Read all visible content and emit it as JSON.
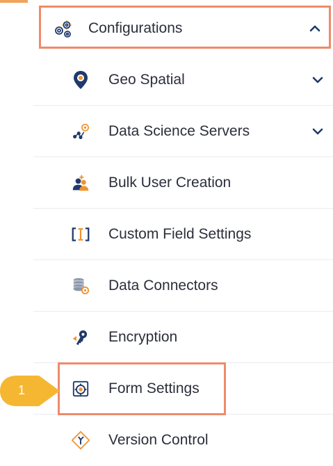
{
  "menu": {
    "header": {
      "label": "Configurations",
      "icon": "gears-icon",
      "expanded": true
    },
    "items": [
      {
        "label": "Geo Spatial",
        "icon": "map-pin-icon",
        "has_chevron": true
      },
      {
        "label": "Data Science Servers",
        "icon": "data-science-icon",
        "has_chevron": true
      },
      {
        "label": "Bulk User Creation",
        "icon": "users-add-icon",
        "has_chevron": false
      },
      {
        "label": "Custom Field Settings",
        "icon": "custom-field-icon",
        "has_chevron": false
      },
      {
        "label": "Data Connectors",
        "icon": "database-gear-icon",
        "has_chevron": false
      },
      {
        "label": "Encryption",
        "icon": "key-icon",
        "has_chevron": false
      },
      {
        "label": "Form Settings",
        "icon": "form-gear-icon",
        "has_chevron": false
      },
      {
        "label": "Version Control",
        "icon": "git-branch-icon",
        "has_chevron": false
      }
    ]
  },
  "annotation": {
    "step_number": "1",
    "highlighted_item": "Form Settings"
  },
  "colors": {
    "highlight_border": "#ef8a6a",
    "callout_fill": "#f5b731",
    "icon_navy": "#1f3a6b",
    "icon_orange": "#f0922e",
    "divider": "#e8ecf1"
  }
}
